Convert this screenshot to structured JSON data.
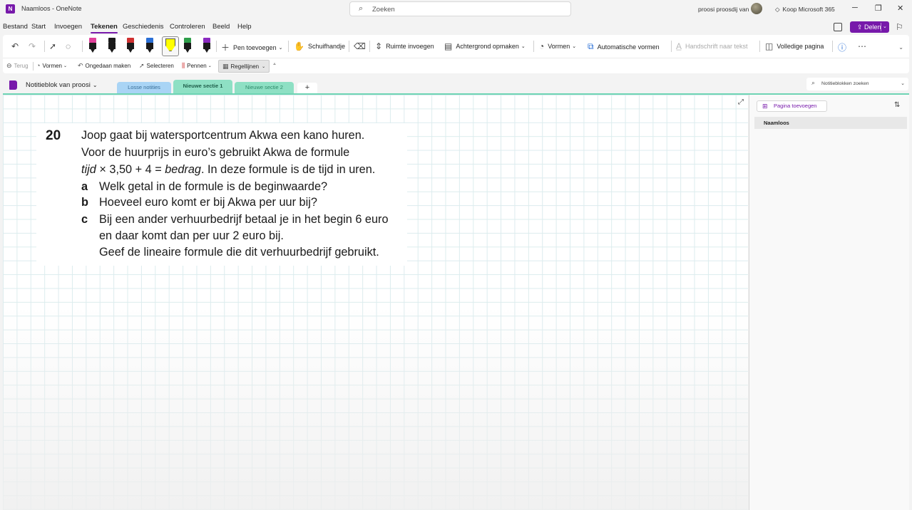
{
  "titlebar": {
    "app_title": "Naamloos - OneNote",
    "search_label": "Zoeken",
    "user_name": "proosi proosdij van",
    "koop_label": "Koop Microsoft 365"
  },
  "menu": {
    "tabs": [
      "Bestand",
      "Start",
      "Invoegen",
      "Tekenen",
      "Geschiedenis",
      "Controleren",
      "Beeld",
      "Help"
    ],
    "active": "Tekenen",
    "share_label": "Delen"
  },
  "ribbon": {
    "pens": [
      {
        "tip": "#e0409a"
      },
      {
        "tip": "#1a1a1a"
      },
      {
        "tip": "#d03030"
      },
      {
        "tip": "#2a6fd6"
      },
      {
        "tip": "#ffff00"
      },
      {
        "tip": "#2e9e4a"
      },
      {
        "tip": "#8b2ac0"
      }
    ],
    "pen_add_label": "Pen toevoegen",
    "hand_label": "Schuifhandje",
    "space_label": "Ruimte invoegen",
    "background_label": "Achtergrond opmaken",
    "shapes_label": "Vormen",
    "auto_shapes_label": "Automatische vormen",
    "ink_to_text_label": "Handschrift naar tekst",
    "full_page_label": "Volledige pagina"
  },
  "toolbar2": {
    "back_label": "Terug",
    "shapes_label": "Vormen",
    "undo_label": "Ongedaan maken",
    "select_label": "Selecteren",
    "pens_label": "Pennen",
    "rule_lines_label": "Regellijnen"
  },
  "notebook": {
    "name": "Notitieblok van proosi",
    "sections": [
      {
        "label": "Losse notities",
        "color": "#a9d4f5",
        "text": "#3a6f99"
      },
      {
        "label": "Nieuwe sectie 1",
        "color": "#8ee0c4",
        "text": "#1f5e4a"
      },
      {
        "label": "Nieuwe sectie 2",
        "color": "#8ee0c4",
        "text": "#2e8a6a"
      }
    ],
    "add_section_label": "+",
    "search_label": "Notitieblokken zoeken"
  },
  "page": {
    "question_number": "20",
    "lines": [
      "Joop gaat bij watersportcentrum Akwa een kano huren.",
      "Voor de huurprijs in euro’s gebruikt Akwa de formule"
    ],
    "formula": {
      "italic1": "tijd",
      "mid": " × 3,50 + 4 = ",
      "italic2": "bedrag",
      "rest": ". In deze formule is de tijd in uren."
    },
    "sub_questions": [
      {
        "letter": "a",
        "lines": [
          "Welk getal in de formule is de beginwaarde?"
        ]
      },
      {
        "letter": "b",
        "lines": [
          "Hoeveel euro komt er bij Akwa per uur bij?"
        ]
      },
      {
        "letter": "c",
        "lines": [
          "Bij een ander verhuurbedrijf betaal je in het begin 6 euro",
          "en daar komt dan per uur 2 euro bij.",
          "Geef de lineaire formule die dit verhuurbedrijf gebruikt."
        ]
      }
    ]
  },
  "pages_panel": {
    "add_page_label": "Pagina toevoegen",
    "pages": [
      "Naamloos"
    ]
  }
}
